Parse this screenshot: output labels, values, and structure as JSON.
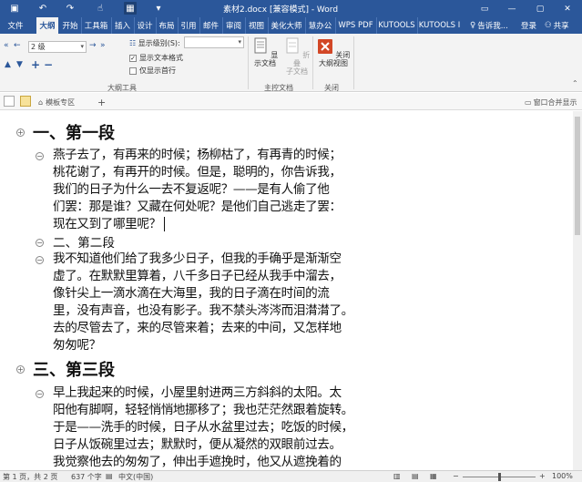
{
  "titlebar": {
    "title": "素材2.docx [兼容模式] - Word",
    "qa_icons": [
      "save-icon",
      "undo-icon",
      "redo-icon",
      "touch-mode-icon",
      "outline-view-icon",
      "customize-icon"
    ],
    "qa_glyphs": [
      "▣",
      "↶",
      "↷",
      "☝",
      "▦",
      "▾"
    ]
  },
  "tabs": [
    {
      "label": "文件",
      "active": false
    },
    {
      "label": "大纲",
      "active": true
    },
    {
      "label": "开始",
      "active": false
    },
    {
      "label": "工具箱",
      "active": false
    },
    {
      "label": "插入",
      "active": false
    },
    {
      "label": "设计",
      "active": false
    },
    {
      "label": "布局",
      "active": false
    },
    {
      "label": "引用",
      "active": false
    },
    {
      "label": "邮件",
      "active": false
    },
    {
      "label": "审阅",
      "active": false
    },
    {
      "label": "视图",
      "active": false
    },
    {
      "label": "美化大师",
      "active": false
    },
    {
      "label": "慧办公",
      "active": false
    },
    {
      "label": "WPS PDF",
      "active": false
    },
    {
      "label": "KUTOOLS",
      "active": false
    },
    {
      "label": "KUTOOLS I",
      "active": false
    }
  ],
  "tell_me": "告诉我...",
  "login": "登录",
  "share": "共享",
  "ribbon": {
    "level_value": "2 级",
    "show_level_label": "显示级别(S):",
    "show_text_format": "显示文本格式",
    "show_first_line": "仅显示首行",
    "outline_tools_label": "大纲工具",
    "show_document": "显示文档",
    "collapse_subdoc_1": "折叠",
    "collapse_subdoc_2": "子文档",
    "master_doc_label": "主控文档",
    "close_outline_1": "关闭",
    "close_outline_2": "大纲视图",
    "close_label": "关闭"
  },
  "docbar": {
    "template_tab": "模板专区",
    "add_tab": "+",
    "window_merge": "窗口合并显示"
  },
  "doc": {
    "heading1": "一、第一段",
    "para1": [
      "燕子去了，有再来的时候；杨柳枯了，有再青的时候；",
      "桃花谢了，有再开的时候。但是，聪明的，你告诉我，",
      "我们的日子为什么一去不复返呢？——是有人偷了他",
      "们罢：那是谁？又藏在何处呢？是他们自己逃走了罢：",
      "现在又到了哪里呢？"
    ],
    "heading2": "二、第二段",
    "para2": [
      "我不知道他们给了我多少日子，但我的手确乎是渐渐空",
      "虚了。在默默里算着，八千多日子已经从我手中溜去，",
      "像针尖上一滴水滴在大海里，我的日子滴在时间的流",
      "里，没有声音，也没有影子。我不禁头涔涔而泪潸潸了。",
      "去的尽管去了，来的尽管来着；去来的中间，又怎样地",
      "匆匆呢？"
    ],
    "heading3": "三、第三段",
    "para3": [
      "早上我起来的时候，小屋里射进两三方斜斜的太阳。太",
      "阳他有脚啊，轻轻悄悄地挪移了；我也茫茫然跟着旋转。",
      "于是——洗手的时候，日子从水盆里过去；吃饭的时候，",
      "日子从饭碗里过去；默默时，便从凝然的双眼前过去。",
      "我觉察他去的匆匆了，伸出手遮挽时，他又从遮挽着的"
    ]
  },
  "status": {
    "page": "第 1 页，共 2 页",
    "words": "637 个字",
    "language": "中文(中国)",
    "zoom": "100%",
    "zoom_minus": "−",
    "zoom_plus": "+"
  },
  "colors": {
    "accent": "#2b579a",
    "close_red": "#d24726"
  }
}
